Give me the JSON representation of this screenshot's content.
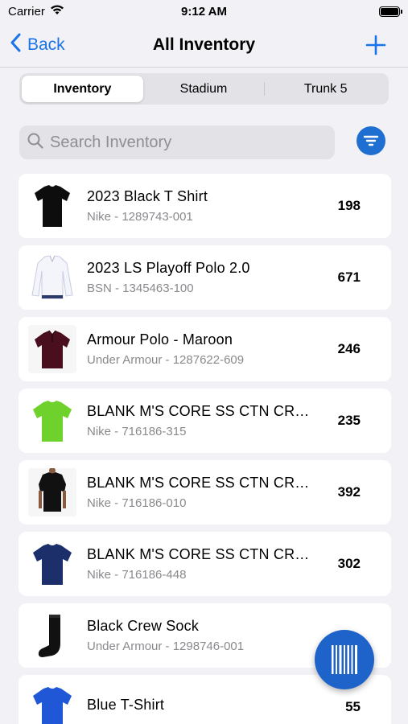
{
  "status_bar": {
    "carrier": "Carrier",
    "time": "9:12 AM"
  },
  "nav": {
    "back_label": "Back",
    "title": "All Inventory"
  },
  "tabs": [
    {
      "label": "Inventory",
      "active": true
    },
    {
      "label": "Stadium",
      "active": false
    },
    {
      "label": "Trunk 5",
      "active": false
    }
  ],
  "search": {
    "placeholder": "Search Inventory",
    "value": ""
  },
  "items": [
    {
      "name": "2023 Black T Shirt",
      "subtitle": "Nike - 1289743-001",
      "quantity": "198",
      "icon": "black-tshirt"
    },
    {
      "name": "2023 LS Playoff Polo 2.0",
      "subtitle": "BSN - 1345463-100",
      "quantity": "671",
      "icon": "white-longsleeve-polo"
    },
    {
      "name": "Armour Polo - Maroon",
      "subtitle": "Under Armour - 1287622-609",
      "quantity": "246",
      "icon": "maroon-polo"
    },
    {
      "name": "BLANK M'S CORE SS CTN CRE...",
      "subtitle": "Nike - 716186-315",
      "quantity": "235",
      "icon": "green-tshirt"
    },
    {
      "name": "BLANK M'S CORE SS CTN CRE...",
      "subtitle": "Nike - 716186-010",
      "quantity": "392",
      "icon": "black-tshirt-model"
    },
    {
      "name": "BLANK M'S CORE SS CTN CRE...",
      "subtitle": "Nike - 716186-448",
      "quantity": "302",
      "icon": "navy-tshirt"
    },
    {
      "name": "Black Crew Sock",
      "subtitle": "Under Armour - 1298746-001",
      "quantity": "",
      "icon": "black-sock"
    },
    {
      "name": "Blue T-Shirt",
      "subtitle": "",
      "quantity": "55",
      "icon": "blue-tshirt"
    }
  ],
  "colors": {
    "accent": "#1a73e8",
    "fab": "#1e63c9",
    "background": "#f2f2f6"
  }
}
